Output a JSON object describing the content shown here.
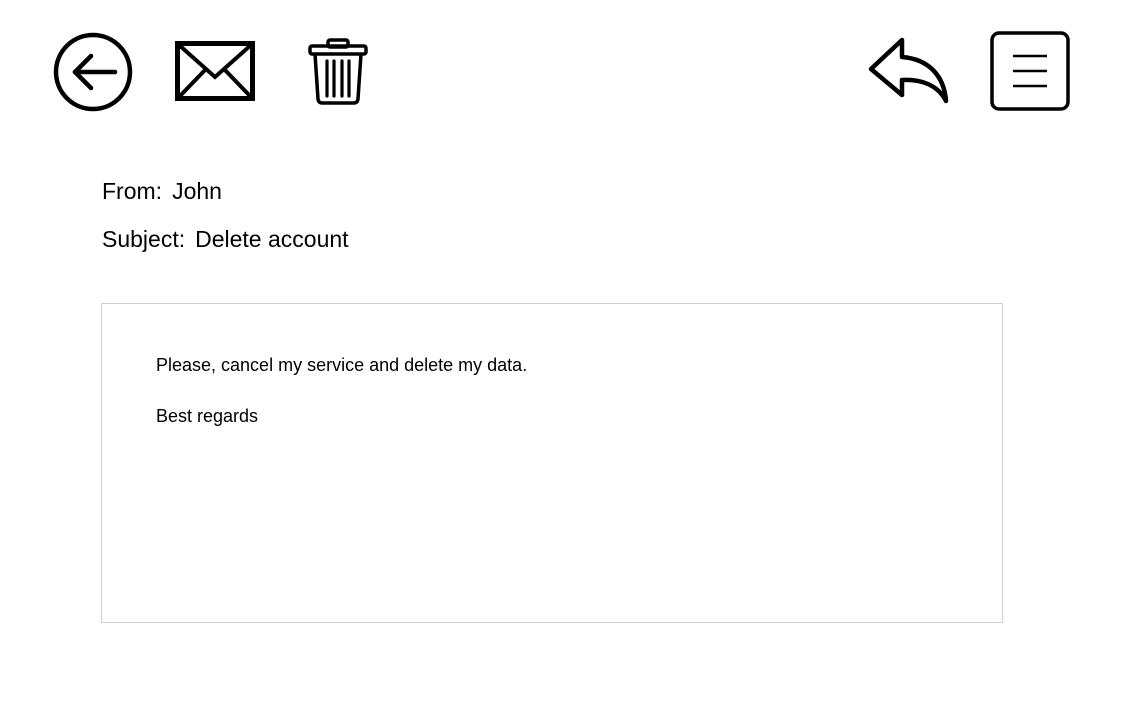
{
  "toolbar": {
    "left_icons": [
      "back-arrow-circle-icon",
      "envelope-icon",
      "trash-icon"
    ],
    "right_icons": [
      "reply-arrow-icon",
      "hamburger-menu-icon"
    ]
  },
  "email": {
    "from_label": "From:",
    "from_value": "John",
    "subject_label": "Subject:",
    "subject_value": "Delete account",
    "body_lines": [
      "Please, cancel my service and delete my data.",
      "Best regards"
    ]
  },
  "colors": {
    "icon_stroke": "#000000",
    "box_border": "#d0d0d0",
    "background": "#ffffff"
  }
}
